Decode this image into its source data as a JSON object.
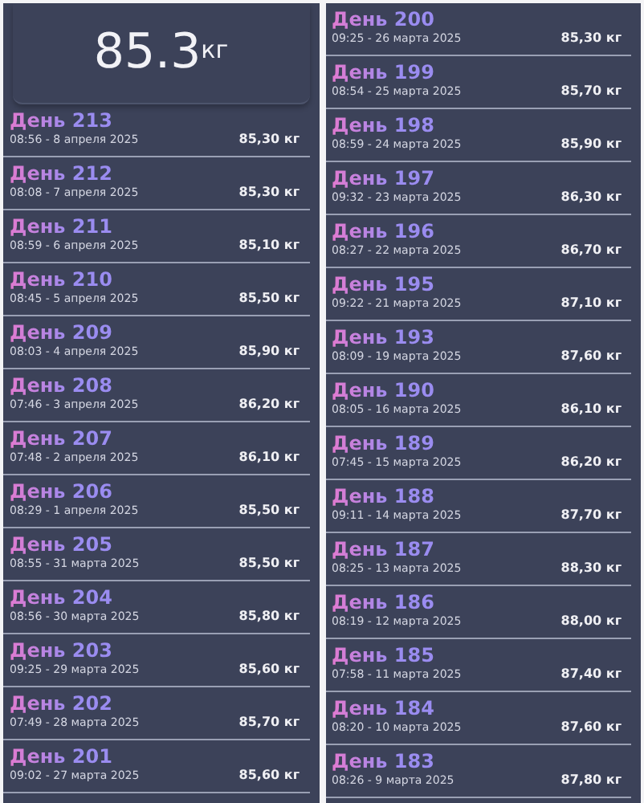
{
  "screens": [
    {
      "total": {
        "value": "85.3",
        "unit": "кг"
      },
      "entries": [
        {
          "title": "День 213",
          "time": "08:56 - 8 апреля 2025",
          "weight": "85,30 кг"
        },
        {
          "title": "День 212",
          "time": "08:08 - 7 апреля 2025",
          "weight": "85,30 кг"
        },
        {
          "title": "День 211",
          "time": "08:59 - 6 апреля 2025",
          "weight": "85,10 кг"
        },
        {
          "title": "День 210",
          "time": "08:45 - 5 апреля 2025",
          "weight": "85,50 кг"
        },
        {
          "title": "День 209",
          "time": "08:03 - 4 апреля 2025",
          "weight": "85,90 кг"
        },
        {
          "title": "День 208",
          "time": "07:46 - 3 апреля 2025",
          "weight": "86,20 кг"
        },
        {
          "title": "День 207",
          "time": "07:48 - 2 апреля 2025",
          "weight": "86,10 кг"
        },
        {
          "title": "День 206",
          "time": "08:29 - 1 апреля 2025",
          "weight": "85,50 кг"
        },
        {
          "title": "День 205",
          "time": "08:55 - 31 марта 2025",
          "weight": "85,50 кг"
        },
        {
          "title": "День 204",
          "time": "08:56 - 30 марта 2025",
          "weight": "85,80 кг"
        },
        {
          "title": "День 203",
          "time": "09:25 - 29 марта 2025",
          "weight": "85,60 кг"
        },
        {
          "title": "День 202",
          "time": "07:49 - 28 марта 2025",
          "weight": "85,70 кг"
        },
        {
          "title": "День 201",
          "time": "09:02 - 27 марта 2025",
          "weight": "85,60 кг"
        }
      ]
    },
    {
      "entries": [
        {
          "title": "День 200",
          "time": "09:25 - 26 марта 2025",
          "weight": "85,30 кг"
        },
        {
          "title": "День 199",
          "time": "08:54 - 25 марта 2025",
          "weight": "85,70 кг"
        },
        {
          "title": "День 198",
          "time": "08:59 - 24 марта 2025",
          "weight": "85,90 кг"
        },
        {
          "title": "День 197",
          "time": "09:32 - 23 марта 2025",
          "weight": "86,30 кг"
        },
        {
          "title": "День 196",
          "time": "08:27 - 22 марта 2025",
          "weight": "86,70 кг"
        },
        {
          "title": "День 195",
          "time": "09:22 - 21 марта 2025",
          "weight": "87,10 кг"
        },
        {
          "title": "День 193",
          "time": "08:09 - 19 марта 2025",
          "weight": "87,60 кг"
        },
        {
          "title": "День 190",
          "time": "08:05 - 16 марта 2025",
          "weight": "86,10 кг"
        },
        {
          "title": "День 189",
          "time": "07:45 - 15 марта 2025",
          "weight": "86,20 кг"
        },
        {
          "title": "День 188",
          "time": "09:11 - 14 марта 2025",
          "weight": "87,70 кг"
        },
        {
          "title": "День 187",
          "time": "08:25 - 13 марта 2025",
          "weight": "88,30 кг"
        },
        {
          "title": "День 186",
          "time": "08:19 - 12 марта 2025",
          "weight": "88,00 кг"
        },
        {
          "title": "День 185",
          "time": "07:58 - 11 марта 2025",
          "weight": "87,40 кг"
        },
        {
          "title": "День 184",
          "time": "08:20 - 10 марта 2025",
          "weight": "87,60 кг"
        },
        {
          "title": "День 183",
          "time": "08:26 - 9 марта 2025",
          "weight": "87,80 кг"
        }
      ]
    }
  ]
}
